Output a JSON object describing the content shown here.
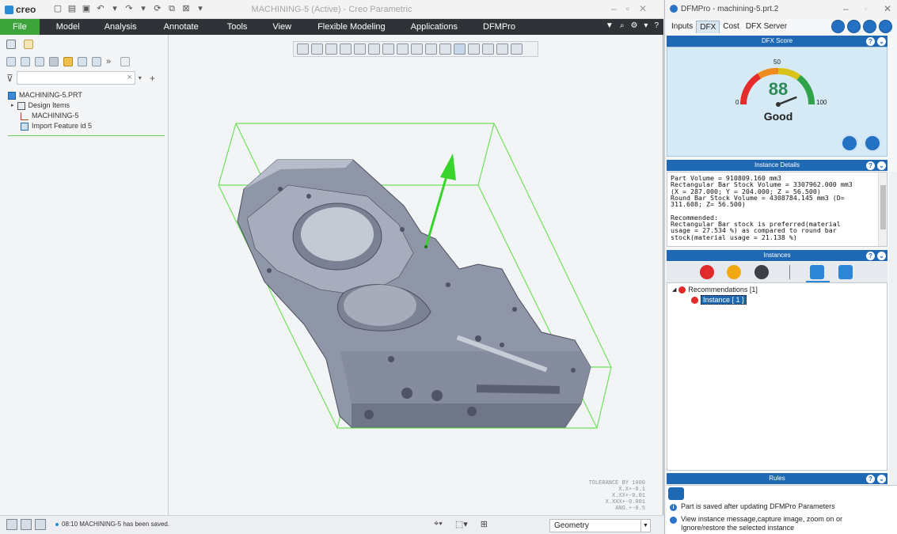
{
  "creo": {
    "logo_text": "creo",
    "window_title": "MACHINING-5 (Active) - Creo Parametric",
    "ribbon_tabs": [
      "File",
      "Model",
      "Analysis",
      "Annotate",
      "Tools",
      "View",
      "Flexible Modeling",
      "Applications",
      "DFMPro"
    ],
    "ribbon_help": "?",
    "model_tree": {
      "filter_placeholder": "",
      "filter_clear": "×",
      "items": [
        {
          "label": "MACHINING-5.PRT",
          "icon": "part-icon"
        },
        {
          "label": "Design Items",
          "icon": "design-items-icon"
        },
        {
          "label": "MACHINING-5",
          "icon": "coordinate-system-icon"
        },
        {
          "label": "Import Feature id 5",
          "icon": "import-feature-icon"
        }
      ]
    },
    "tolerance_block": [
      "TOLERANCE BY 1000",
      "X.X+-0.1",
      "X.XX+-0.01",
      "X.XXX+-0.001",
      "ANG.+-0.5"
    ],
    "status_message": "08:10 MACHINING-5 has been saved.",
    "selection_filter": "Geometry"
  },
  "dfmpro": {
    "window_title": "DFMPro - machining-5.prt.2",
    "tabs": [
      "Inputs",
      "DFX",
      "Cost",
      "DFX Server"
    ],
    "active_tab": "DFX",
    "dfx_score": {
      "header": "DFX Score",
      "score": 88,
      "min_label": "0",
      "mid_label": "50",
      "max_label": "100",
      "rating": "Good"
    },
    "instance_details": {
      "header": "Instance Details",
      "text": "Part Volume = 910809.160 mm3\nRectangular Bar Stock Volume = 3307962.000 mm3\n(X = 287.000; Y = 204.000; Z = 56.500)\nRound Bar Stock Volume = 4308784.145 mm3 (D=\n311.608; Z= 56.500)\n\nRecommended:\nRectangular Bar stock is preferred(material\nusage = 27.534 %) as compared to round bar\nstock(material usage = 21.138 %)"
    },
    "instances": {
      "header": "Instances",
      "tree_parent": "Recommendations [1]",
      "tree_child": "Instance [ 1 ]"
    },
    "rules": {
      "header": "Rules",
      "messages": [
        "Part is saved after updating DFMPro Parameters",
        "View instance message,capture image, zoom on or Ignore/restore the selected instance"
      ]
    },
    "colors": {
      "header_blue": "#1f68b4",
      "score_green": "#2e8b57",
      "ribbon_dark": "#2f3337",
      "file_green": "#3ca43a"
    }
  }
}
